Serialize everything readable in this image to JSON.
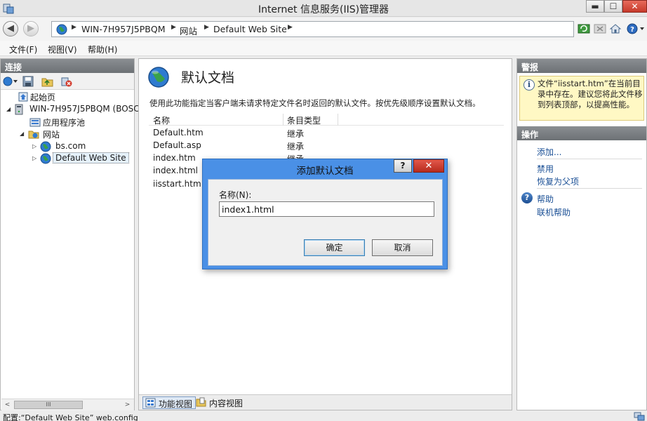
{
  "window": {
    "title": "Internet 信息服务(IIS)管理器",
    "min_label": "▬",
    "max_label": "☐",
    "close_label": "✕"
  },
  "address": {
    "crumbs": [
      "WIN-7H957J5PBQM",
      "网站",
      "Default Web Site"
    ],
    "separator": "▶"
  },
  "menu": [
    "文件(F)",
    "视图(V)",
    "帮助(H)"
  ],
  "left_panel": {
    "header": "连接",
    "tree": [
      {
        "label": "起始页",
        "icon": "start-page-icon"
      },
      {
        "label": "WIN-7H957J5PBQM (BOSC",
        "icon": "server-icon",
        "expander": "◢"
      },
      {
        "label": "应用程序池",
        "icon": "app-pool-icon"
      },
      {
        "label": "网站",
        "icon": "sites-folder-icon",
        "expander": "◢"
      },
      {
        "label": "bs.com",
        "icon": "globe-icon",
        "expander": "▷"
      },
      {
        "label": "Default Web Site",
        "icon": "globe-icon",
        "expander": "▷",
        "selected": true
      }
    ],
    "scroll_left": "<",
    "scroll_right": ">",
    "scroll_grip": "III"
  },
  "center": {
    "title": "默认文档",
    "description": "使用此功能指定当客户端未请求特定文件名时返回的默认文件。按优先级顺序设置默认文档。",
    "columns": [
      "名称",
      "条目类型"
    ],
    "rows": [
      {
        "name": "Default.htm",
        "type": "继承"
      },
      {
        "name": "Default.asp",
        "type": "继承"
      },
      {
        "name": "index.htm",
        "type": "继承"
      },
      {
        "name": "index.html",
        "type": ""
      },
      {
        "name": "iisstart.htm",
        "type": ""
      }
    ],
    "tabs": [
      "功能视图",
      "内容视图"
    ]
  },
  "right_panel": {
    "alerts_header": "警报",
    "alert_text": "文件“iisstart.htm”在当前目录中存在。建议您将此文件移到列表顶部，以提高性能。",
    "actions_header": "操作",
    "actions": [
      "添加...",
      "禁用",
      "恢复为父项",
      "帮助",
      "联机帮助"
    ]
  },
  "dialog": {
    "title": "添加默认文档",
    "help_label": "?",
    "close_label": "✕",
    "name_label": "名称(N):",
    "name_value": "index1.html",
    "ok_label": "确定",
    "cancel_label": "取消"
  },
  "status": {
    "text": "配置:“Default Web Site” web.config"
  }
}
